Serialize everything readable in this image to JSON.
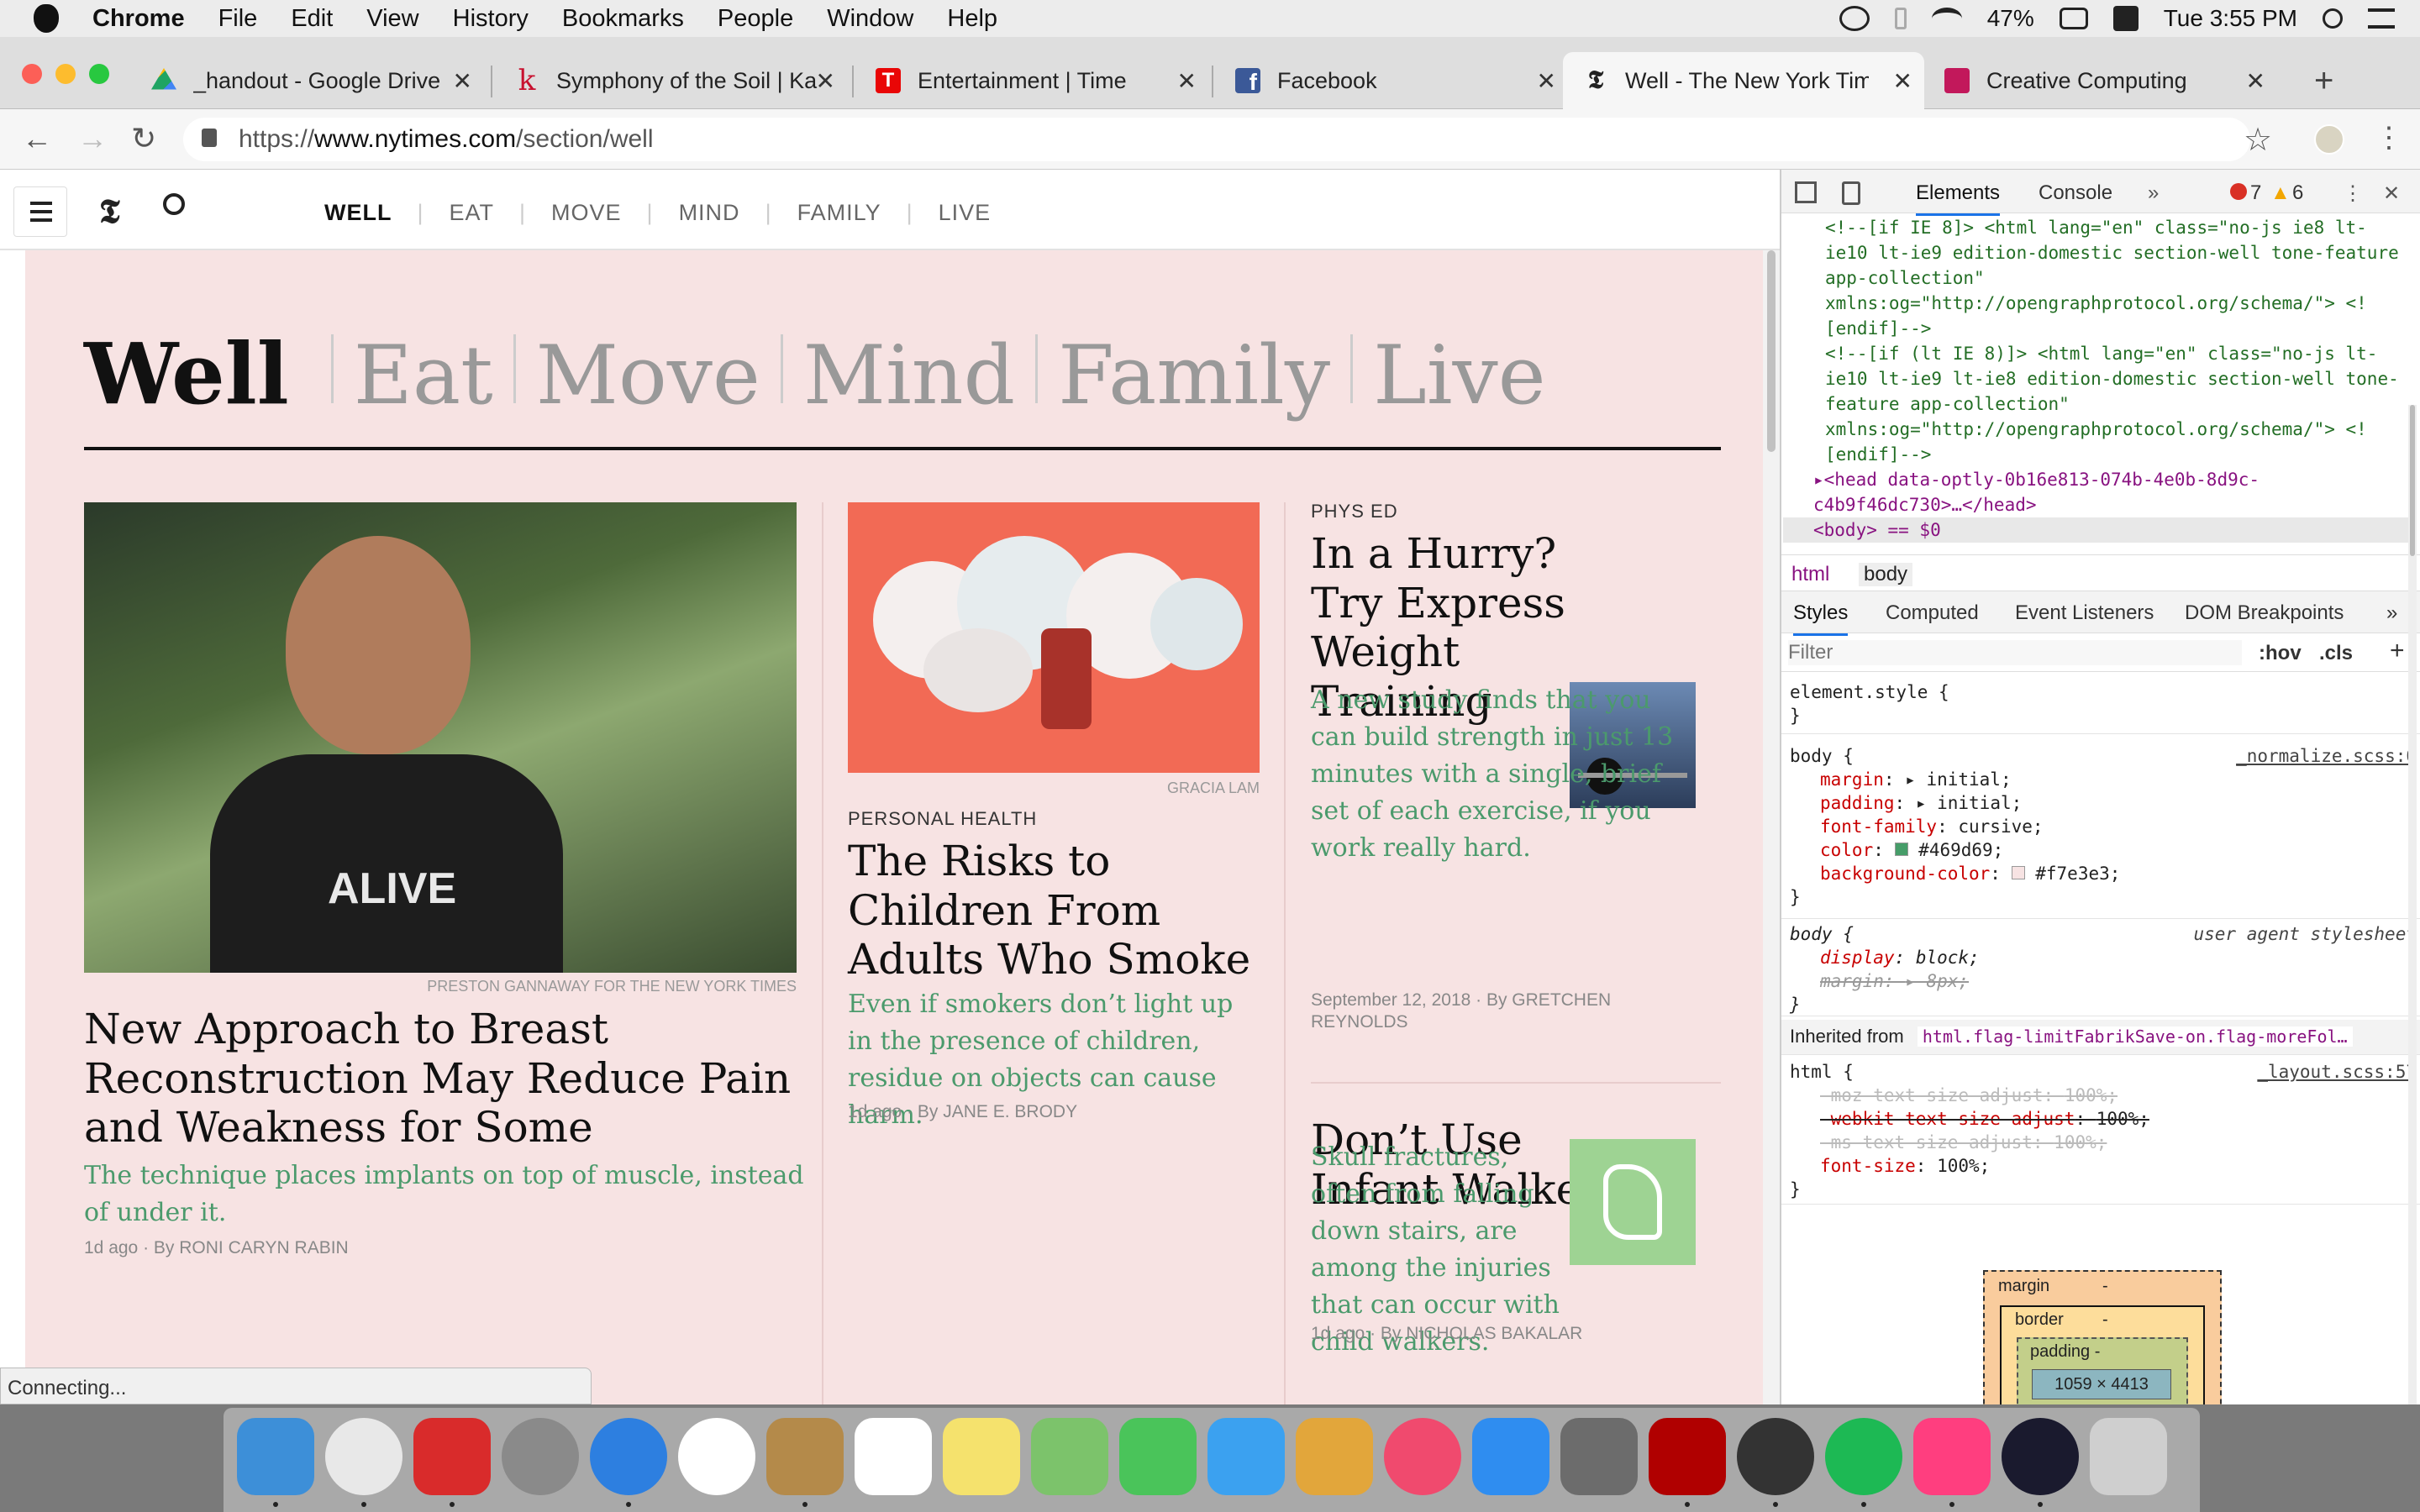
{
  "menubar": {
    "app": "Chrome",
    "items": [
      "File",
      "Edit",
      "View",
      "History",
      "Bookmarks",
      "People",
      "Window",
      "Help"
    ],
    "battery": "47%",
    "clock": "Tue 3:55 PM"
  },
  "tabs": [
    {
      "title": "_handout - Google Drive",
      "favicon_color": "#1fa463"
    },
    {
      "title": "Symphony of the Soil | Ka",
      "favicon_color": "#c8102e"
    },
    {
      "title": "Entertainment | Time",
      "favicon_color": "#e90606"
    },
    {
      "title": "Facebook",
      "favicon_color": "#3b5998"
    },
    {
      "title": "Well - The New York Time",
      "favicon_color": "#111111",
      "active": true
    },
    {
      "title": "Creative Computing",
      "favicon_color": "#c2185b"
    }
  ],
  "new_tab": "+",
  "url": {
    "scheme": "https://",
    "host": "www.nytimes.com",
    "path": "/section/well"
  },
  "site_nav": {
    "items": [
      "WELL",
      "EAT",
      "MOVE",
      "MIND",
      "FAMILY",
      "LIVE"
    ]
  },
  "section_header": {
    "title": "Well",
    "subs": [
      "Eat",
      "Move",
      "Mind",
      "Family",
      "Live"
    ]
  },
  "articles": [
    {
      "credit": "PRESTON GANNAWAY FOR THE NEW YORK TIMES",
      "headline": "New Approach to Breast Reconstruction May Reduce Pain and Weakness for Some",
      "summary": "The technique places implants on top of muscle, instead of under it.",
      "meta": "1d ago · By RONI CARYN RABIN",
      "shirt": "ALIVE"
    },
    {
      "credit": "GRACIA LAM",
      "kicker": "PERSONAL HEALTH",
      "headline": "The Risks to Children From Adults Who Smoke",
      "summary": "Even if smokers don’t light up in the presence of children, residue on objects can cause harm.",
      "meta": "1d ago · By JANE E. BRODY"
    },
    {
      "kicker": "PHYS ED",
      "headline": "In a Hurry? Try Express Weight Training",
      "summary": "A new study finds that you can build strength in just 13 minutes with a single, brief set of each exercise, if you work really hard.",
      "meta": "September 12, 2018 · By GRETCHEN REYNOLDS"
    },
    {
      "headline": "Don’t Use Infant Walkers",
      "summary": "Skull fractures, often from falling down stairs, are among the injuries that can occur with child walkers.",
      "meta": "1d ago · By NICHOLAS BAKALAR"
    }
  ],
  "status": "Connecting...",
  "devtools": {
    "tabs": [
      "Elements",
      "Console"
    ],
    "errors": "7",
    "warnings": "6",
    "dom_lines": [
      "<!--[if IE 8]> <html lang=\"en\" class=\"no-js ie8 lt-ie10 lt-ie9 edition-domestic section-well tone-feature app-collection\" xmlns:og=\"http://opengraphprotocol.org/schema/\"> <![endif]-->",
      "<!--[if (lt IE 8)]> <html lang=\"en\" class=\"no-js lt-ie10 lt-ie9 lt-ie8 edition-domestic section-well tone-feature app-collection\" xmlns:og=\"http://opengraphprotocol.org/schema/\"> <![endif]-->",
      "<head data-optly-0b16e813-074b-4e0b-8d9c-c4b9f46dc730>…</head>",
      "<body> == $0"
    ],
    "breadcrumbs": [
      "html",
      "body"
    ],
    "style_tabs": [
      "Styles",
      "Computed",
      "Event Listeners",
      "DOM Breakpoints"
    ],
    "filter_placeholder": "Filter",
    "hov": ":hov",
    "cls": ".cls",
    "element_style": "element.style {",
    "body_rule": {
      "selector": "body {",
      "source": "_normalize.scss:6",
      "props": [
        {
          "name": "margin",
          "value": "▸ initial;"
        },
        {
          "name": "padding",
          "value": "▸ initial;"
        },
        {
          "name": "font-family",
          "value": "cursive;"
        },
        {
          "name": "color",
          "value": "#469d69;"
        },
        {
          "name": "background-color",
          "value": "#f7e3e3;"
        }
      ]
    },
    "ua_rule": {
      "selector": "body {",
      "source": "user agent stylesheet",
      "props": [
        {
          "name": "display",
          "value": "block;"
        },
        {
          "name": "margin",
          "value": "▸ 8px;"
        }
      ]
    },
    "inherited_label": "Inherited from",
    "inherited_from": "html.flag-limitFabrikSave-on.flag-moreFol…",
    "html_rule": {
      "selector": "html {",
      "source": "_layout.scss:57",
      "props": [
        {
          "name": "-moz-text-size-adjust",
          "value": "100%;"
        },
        {
          "name": "-webkit-text-size-adjust",
          "value": "100%;"
        },
        {
          "name": "-ms-text-size-adjust",
          "value": "100%;"
        },
        {
          "name": "font-size",
          "value": "100%;"
        }
      ]
    },
    "boxmodel": {
      "margin": "margin",
      "margin_val": "-",
      "border": "border",
      "border_val": "-",
      "padding": "padding -",
      "content": "1059 × 4413"
    }
  },
  "dock_colors": [
    "#3d8fd8",
    "#e8e8e8",
    "#d92b2b",
    "#8a8a8a",
    "#2d7fe0",
    "#ffffff",
    "#b48a4a",
    "#ffffff",
    "#f5e26d",
    "#7cc36b",
    "#4ac45a",
    "#3ba1f0",
    "#e2a63b",
    "#f04a6e",
    "#2f8df0",
    "#6c6c6c",
    "#b00000",
    "#333333",
    "#1db954",
    "#ff3e7f",
    "#1a1a2e",
    "#cfcfcf"
  ]
}
